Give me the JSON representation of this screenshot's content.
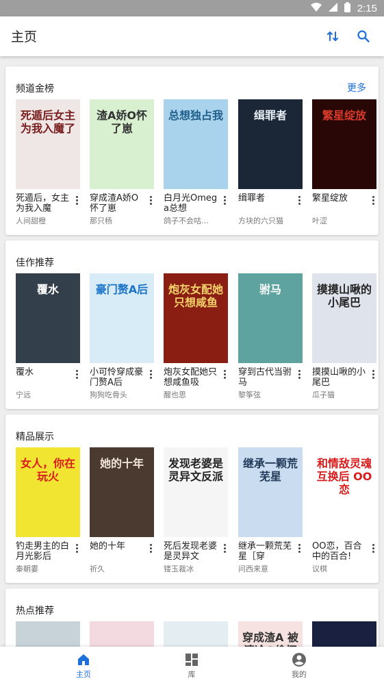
{
  "status_bar": {
    "time": "2:15",
    "icons": [
      "wifi-icon",
      "signal-icon",
      "battery-icon"
    ]
  },
  "app_bar": {
    "title": "主页",
    "actions": [
      "sort-icon",
      "search-icon"
    ]
  },
  "colors": {
    "accent": "#1e6fd9"
  },
  "sections": [
    {
      "title": "频道金榜",
      "more_label": "更多",
      "books": [
        {
          "title": "死遁后，女主为我入魔",
          "author": "人间甜橙",
          "cover_text": "死遁后女主为我入魔了",
          "cover_bg": "#efe6e6",
          "cover_fg": "#7a1d1d"
        },
        {
          "title": "穿成渣A娇O怀了崽",
          "author": "那只杨",
          "cover_text": "渣A娇O怀了崽",
          "cover_bg": "#d8f0d0",
          "cover_fg": "#333333"
        },
        {
          "title": "白月光Omega总想",
          "author": "鸽子不会咕…",
          "cover_text": "总想独占我",
          "cover_bg": "#a9d3ec",
          "cover_fg": "#1f5f8a"
        },
        {
          "title": "缉罪者",
          "author": "方块的六只猫",
          "cover_text": "缉罪者",
          "cover_bg": "#1b2636",
          "cover_fg": "#e8eef5"
        },
        {
          "title": "繁星绽放",
          "author": "叶涩",
          "cover_text": "繁星绽放",
          "cover_bg": "#2a0707",
          "cover_fg": "#d83a2a"
        }
      ]
    },
    {
      "title": "佳作推荐",
      "books": [
        {
          "title": "覆水",
          "author": "宁远",
          "cover_text": "覆水",
          "cover_bg": "#33404c",
          "cover_fg": "#ffffff"
        },
        {
          "title": "小可怜穿成豪门赘A后",
          "author": "狗狗吃骨头",
          "cover_text": "豪门赘A后",
          "cover_bg": "#d8ecf8",
          "cover_fg": "#1a73c9"
        },
        {
          "title": "炮灰女配她只想咸鱼吸",
          "author": "醒也思",
          "cover_text": "炮灰女配她只想咸鱼",
          "cover_bg": "#8a1e12",
          "cover_fg": "#f5d36b"
        },
        {
          "title": "穿到古代当驸马",
          "author": "黎筝弦",
          "cover_text": "驸马",
          "cover_bg": "#5fa3a0",
          "cover_fg": "#ffffff"
        },
        {
          "title": "摸摸山啾的小尾巴",
          "author": "瓜子猫",
          "cover_text": "摸摸山啾的小尾巴",
          "cover_bg": "#dfe3ec",
          "cover_fg": "#222222"
        }
      ]
    },
    {
      "title": "精品展示",
      "books": [
        {
          "title": "钓走男主的白月光影后",
          "author": "秦朝霎",
          "cover_text": "女人，你在玩火",
          "cover_bg": "#f2e531",
          "cover_fg": "#d81b1b"
        },
        {
          "title": "她的十年",
          "author": "祈久",
          "cover_text": "她的十年",
          "cover_bg": "#4a3a30",
          "cover_fg": "#f1e6d8"
        },
        {
          "title": "死后发现老婆是灵异文",
          "author": "镂玉裁冰",
          "cover_text": "发现老婆是灵异文反派",
          "cover_bg": "#f5f5f5",
          "cover_fg": "#222222"
        },
        {
          "title": "继承一颗荒芜星［穿",
          "author": "问西来意",
          "cover_text": "继承一颗荒芜星",
          "cover_bg": "#c9dcf0",
          "cover_fg": "#223a5a"
        },
        {
          "title": "OO恋，百合中的百合!",
          "author": "议棋",
          "cover_text": "和情敌灵魂互换后 OO恋",
          "cover_bg": "#ffffff",
          "cover_fg": "#d81b1b"
        }
      ]
    },
    {
      "title": "热点推荐",
      "books": [
        {
          "cover_bg": "#c7d2d9"
        },
        {
          "cover_bg": "#f3d9e0"
        },
        {
          "cover_bg": "#e4eef2"
        },
        {
          "cover_text": "穿成渣A 被清冷O偷怀了",
          "cover_bg": "#f6e2e0",
          "cover_fg": "#333333"
        },
        {
          "cover_bg": "#1a2040",
          "cover_fg": "#f5d36b"
        }
      ]
    }
  ],
  "bottom_nav": [
    {
      "label": "主页",
      "icon": "home-icon",
      "active": true
    },
    {
      "label": "库",
      "icon": "library-grid-icon",
      "active": false
    },
    {
      "label": "我的",
      "icon": "account-icon",
      "active": false
    }
  ]
}
